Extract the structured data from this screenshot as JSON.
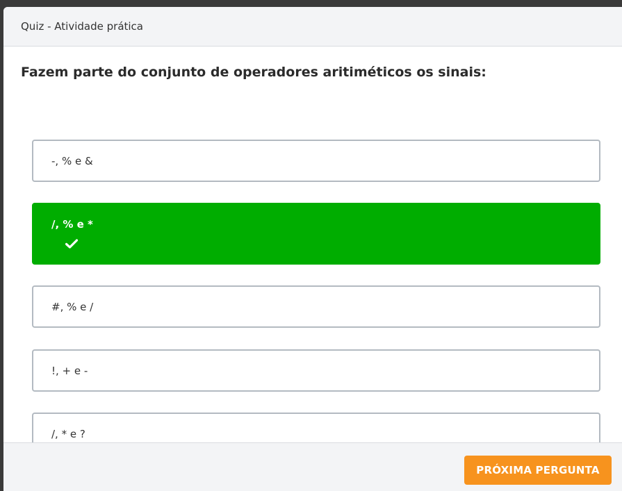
{
  "header": {
    "title": "Quiz - Atividade prática"
  },
  "question": {
    "text": "Fazem parte do conjunto de operadores aritiméticos os sinais:"
  },
  "options": [
    {
      "label": "-, % e &",
      "state": "default"
    },
    {
      "label": "/, % e *",
      "state": "correct",
      "icon": "check-icon"
    },
    {
      "label": "#, % e /",
      "state": "default"
    },
    {
      "label": "!, + e -",
      "state": "default"
    },
    {
      "label": "/, * e ?",
      "state": "default"
    }
  ],
  "footer": {
    "next_label": "PRÓXIMA PERGUNTA"
  },
  "colors": {
    "correct": "#00ad00",
    "accent": "#f7931e",
    "border": "#b3bac1"
  }
}
